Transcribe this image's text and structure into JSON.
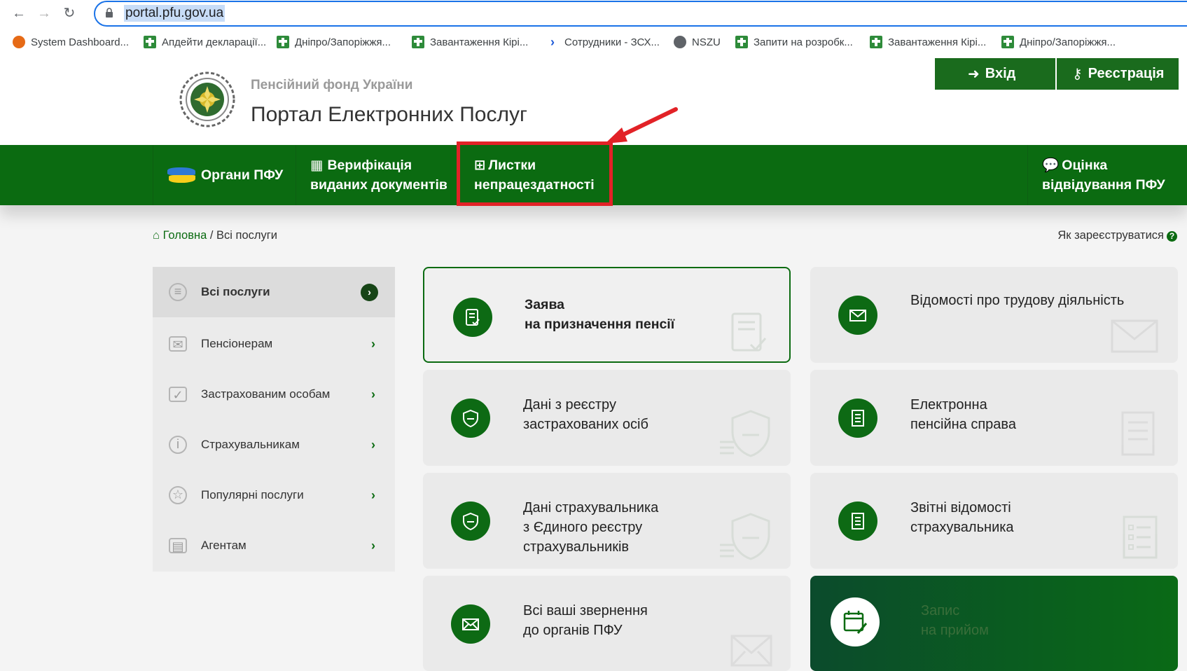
{
  "browser": {
    "url": "portal.pfu.gov.ua",
    "bookmarks": [
      {
        "label": "System Dashboard...",
        "icon": "fox-icon"
      },
      {
        "label": "Апдейти декларації...",
        "icon": "green-cross-icon"
      },
      {
        "label": "Дніпро/Запоріжжя...",
        "icon": "green-cross-icon"
      },
      {
        "label": "Завантаження Кірі...",
        "icon": "green-cross-icon"
      },
      {
        "label": "Сотрудники - ЗСХ...",
        "icon": "chevron-icon"
      },
      {
        "label": "NSZU",
        "icon": "globe-icon"
      },
      {
        "label": "Запити на розробк...",
        "icon": "green-cross-icon"
      },
      {
        "label": "Завантаження Кірі...",
        "icon": "green-cross-icon"
      },
      {
        "label": "Дніпро/Запоріжжя...",
        "icon": "green-cross-icon"
      }
    ]
  },
  "header": {
    "org_name": "Пенсійний фонд України",
    "portal_title": "Портал Електронних Послуг",
    "login_label": "Вхід",
    "register_label": "Реєстрація"
  },
  "nav": {
    "organs": "Органи ПФУ",
    "verification_line1": "Верифікація",
    "verification_line2": "виданих документів",
    "sick_leave_line1": "Листки",
    "sick_leave_line2": "непрацездатності",
    "rating_line1": "Оцінка",
    "rating_line2": "відвідування ПФУ"
  },
  "breadcrumb": {
    "home": "Головна",
    "separator": "/",
    "current": "Всі послуги",
    "how_register": "Як зареєструватися"
  },
  "sidebar": {
    "items": [
      {
        "label": "Всі послуги",
        "active": true
      },
      {
        "label": "Пенсіонерам"
      },
      {
        "label": "Застрахованим особам"
      },
      {
        "label": "Страхувальникам"
      },
      {
        "label": "Популярні послуги"
      },
      {
        "label": "Агентам"
      }
    ]
  },
  "cards": {
    "pension_app": {
      "line1": "Заява",
      "line2": "на призначення пенсії"
    },
    "work_info": {
      "line1": "Відомості про трудову діяльність"
    },
    "insured_registry": {
      "line1": "Дані з реєстру",
      "line2": "застрахованих осіб"
    },
    "e_pension_case": {
      "line1": "Електронна",
      "line2": "пенсійна справа"
    },
    "insurer_data": {
      "line1": "Дані страхувальника",
      "line2": "з Єдиного реєстру",
      "line3": "страхувальників"
    },
    "insurer_reports": {
      "line1": "Звітні відомості",
      "line2": "страхувальника"
    },
    "appeals": {
      "line1": "Всі ваші звернення",
      "line2": "до органів ПФУ"
    },
    "appointment": {
      "line1": "Запис",
      "line2": "на прийом"
    }
  },
  "colors": {
    "brand_green": "#0b6b11",
    "highlight_red": "#e22227"
  }
}
